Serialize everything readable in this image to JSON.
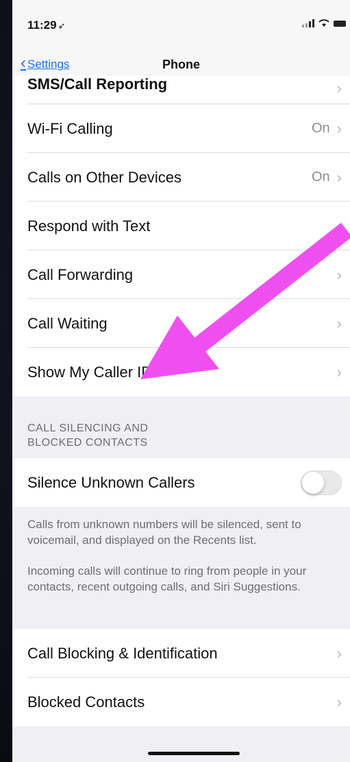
{
  "status": {
    "time": "11:29",
    "location_glyph": "➶"
  },
  "nav": {
    "back_label": "Settings",
    "title": "Phone"
  },
  "group1": {
    "rows": [
      {
        "label": "SMS/Call Reporting",
        "value": ""
      },
      {
        "label": "Wi-Fi Calling",
        "value": "On"
      },
      {
        "label": "Calls on Other Devices",
        "value": "On"
      },
      {
        "label": "Respond with Text",
        "value": ""
      },
      {
        "label": "Call Forwarding",
        "value": ""
      },
      {
        "label": "Call Waiting",
        "value": ""
      },
      {
        "label": "Show My Caller ID",
        "value": ""
      }
    ]
  },
  "silencing": {
    "header_line1": "CALL SILENCING AND",
    "header_line2": "BLOCKED CONTACTS",
    "toggle_label": "Silence Unknown Callers",
    "toggle_on": false,
    "footer_p1": "Calls from unknown numbers will be silenced, sent to voicemail, and displayed on the Recents list.",
    "footer_p2": "Incoming calls will continue to ring from people in your contacts, recent outgoing calls, and Siri Suggestions."
  },
  "group3": {
    "rows": [
      {
        "label": "Call Blocking & Identification"
      },
      {
        "label": "Blocked Contacts"
      }
    ]
  },
  "annotation": {
    "arrow_color": "#f04ff0"
  },
  "colors": {
    "accent": "#1a6ef0",
    "grouped_bg": "#efeff4"
  }
}
